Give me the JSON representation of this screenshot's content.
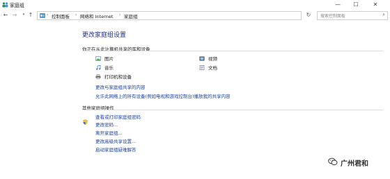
{
  "window": {
    "title": "家庭组",
    "min_glyph": "—",
    "max_glyph": "☐",
    "close_glyph": "✕"
  },
  "nav": {
    "back_glyph": "←",
    "forward_glyph": "→",
    "recent_glyph": "▾",
    "up_glyph": "↑",
    "breadcrumbs": [
      "控制面板",
      "网络和 Internet",
      "家庭组"
    ],
    "separator": "›",
    "dropdown_glyph": "▾",
    "refresh_glyph": "↻",
    "search_placeholder": "搜索控制面板",
    "search_glyph": "⌕"
  },
  "main": {
    "title": "更改家庭组设置",
    "shared_section": {
      "heading": "你正在从此计算机共享的库和设备",
      "items_left": [
        "图片",
        "音乐",
        "打印机和设备"
      ],
      "items_right": [
        "视频",
        "文档"
      ]
    },
    "shared_links": [
      "更改与家庭组共享的内容",
      "允许此网络上的所有设备(例如电视和游戏控制台)播放我的共享内容"
    ],
    "other_section": {
      "heading": "其他家庭组操作",
      "links": [
        "查看或打印家庭组密码",
        "更改密码...",
        "离开家庭组...",
        "更改高级共享设置...",
        "启动家庭组疑难解答"
      ]
    }
  },
  "watermark": {
    "text": "广州君和"
  },
  "colors": {
    "link": "#1a3fa6",
    "title": "#1e3287",
    "icon_green": "#2e8b57"
  }
}
